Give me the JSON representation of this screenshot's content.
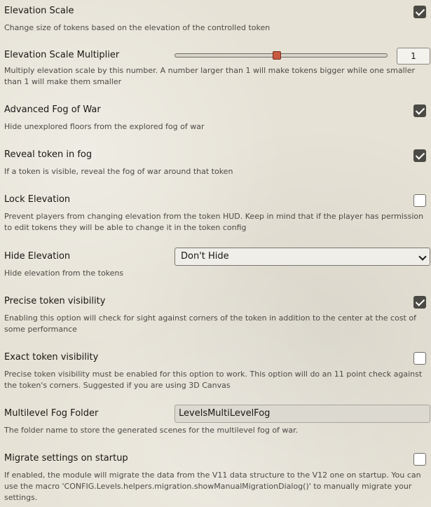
{
  "settings": [
    {
      "label": "Elevation Scale",
      "hint": "Change size of tokens based on the elevation of the controlled token",
      "control": "checkbox",
      "checked": true
    },
    {
      "label": "Elevation Scale Multiplier",
      "hint": "Multiply elevation scale by this number. A number larger than 1 will make tokens bigger while one smaller than 1 will make them smaller",
      "control": "range",
      "value": "1",
      "slider_fraction": 0.48
    },
    {
      "label": "Advanced Fog of War",
      "hint": "Hide unexplored floors from the explored fog of war",
      "control": "checkbox",
      "checked": true
    },
    {
      "label": "Reveal token in fog",
      "hint": "If a token is visible, reveal the fog of war around that token",
      "control": "checkbox",
      "checked": true
    },
    {
      "label": "Lock Elevation",
      "hint": "Prevent players from changing elevation from the token HUD. Keep in mind that if the player has permission to edit tokens they will be able to change it in the token config",
      "control": "checkbox",
      "checked": false
    },
    {
      "label": "Hide Elevation",
      "hint": "Hide elevation from the tokens",
      "control": "select",
      "value": "Don't Hide"
    },
    {
      "label": "Precise token visibility",
      "hint": "Enabling this option will check for sight against corners of the token in addition to the center at the cost of some performance",
      "control": "checkbox",
      "checked": true
    },
    {
      "label": "Exact token visibility",
      "hint": "Precise token visibility must be enabled for this option to work. This option will do an 11 point check against the token's corners. Suggested if you are using 3D Canvas",
      "control": "checkbox",
      "checked": false
    },
    {
      "label": "Multilevel Fog Folder",
      "hint": "The folder name to store the generated scenes for the multilevel fog of war.",
      "control": "text",
      "value": "LevelsMultiLevelFog"
    },
    {
      "label": "Migrate settings on startup",
      "hint": "If enabled, the module will migrate the data from the V11 data structure to the V12 one on startup. You can use the macro 'CONFIG.Levels.helpers.migration.showManualMigrationDialog()' to manually migrate your settings.",
      "control": "checkbox",
      "checked": false
    }
  ]
}
